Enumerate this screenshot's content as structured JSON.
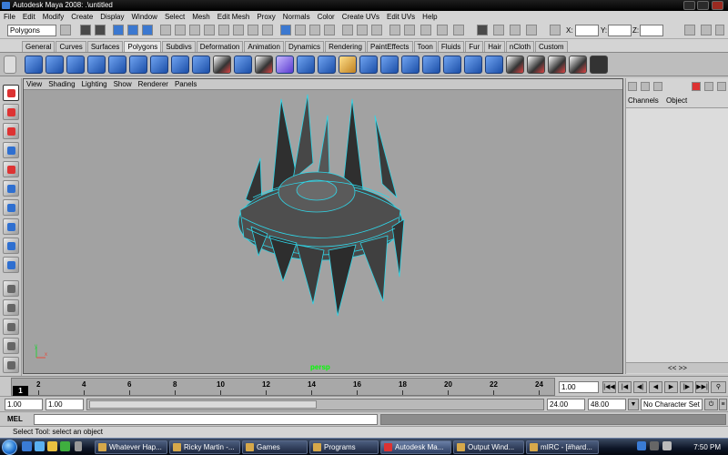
{
  "window": {
    "title": "Autodesk Maya 2008: .\\untitled",
    "controls": [
      "minimize-icon",
      "maximize-icon",
      "close-icon"
    ]
  },
  "menus": [
    "File",
    "Edit",
    "Modify",
    "Create",
    "Display",
    "Window",
    "Select",
    "Mesh",
    "Edit Mesh",
    "Proxy",
    "Normals",
    "Color",
    "Create UVs",
    "Edit UVs",
    "Help"
  ],
  "status_line": {
    "mode": "Polygons",
    "x_label": "X:",
    "y_label": "Y:",
    "z_label": "Z:"
  },
  "shelf_tabs": [
    "General",
    "Curves",
    "Surfaces",
    "Polygons",
    "Subdivs",
    "Deformation",
    "Animation",
    "Dynamics",
    "Rendering",
    "PaintEffects",
    "Toon",
    "Fluids",
    "Fur",
    "Hair",
    "nCloth",
    "Custom"
  ],
  "active_shelf": "Polygons",
  "viewport": {
    "menu": [
      "View",
      "Shading",
      "Lighting",
      "Show",
      "Renderer",
      "Panels"
    ],
    "camera": "persp",
    "axis_labels": {
      "x": "x",
      "y": "y"
    }
  },
  "channel_box": {
    "tabs": [
      "Channels",
      "Object"
    ],
    "scroll_arrows": "<< >>"
  },
  "time_slider": {
    "ticks": [
      "2",
      "4",
      "6",
      "8",
      "10",
      "12",
      "14",
      "16",
      "18",
      "20",
      "22",
      "24"
    ],
    "current_frame": "1",
    "current_time": "1.00"
  },
  "range": {
    "start_time": "1.00",
    "playback_start": "1.00",
    "playback_end": "24.00",
    "end_time": "48.00",
    "character_set": "No Character Set"
  },
  "command_line": {
    "label": "MEL"
  },
  "help_line": "Select Tool: select an object",
  "taskbar": {
    "tasks": [
      "Whatever Hap...",
      "Ricky Martin -...",
      "Games",
      "Programs",
      "Autodesk Ma...",
      "Output Wind...",
      "mIRC - [#hard..."
    ],
    "clock": "7:50 PM"
  },
  "colors": {
    "viewport_bg": "#a2a2a2",
    "wire": "#2fd6e8",
    "mesh": "#3a3a3a",
    "accent": "#3b78d0"
  }
}
